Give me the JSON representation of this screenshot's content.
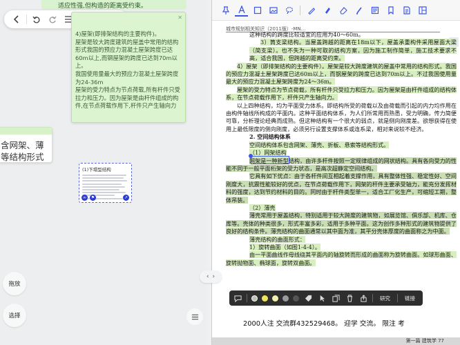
{
  "left_panel": {
    "top_note_text": "适应性强,但构造的距离受约束。",
    "toolbar": {
      "icons": [
        "chevron-left-icon",
        "undo-icon",
        "redo-icon",
        "list-icon",
        "edit-icon",
        "share-icon",
        "more-icon"
      ]
    },
    "note_main": {
      "lines": [
        "4)屋架(即排架结构的主要构件)。",
        "屋架是较大跨度建筑的屋盖中常用的结构形式我国的预应力混凝土屋架跨度已达60m以上,而钢屋架的跨度已达到70m以上。",
        "我国使用量最大的预应力混凝土屋架跨度为24-36m",
        "屋架的受力特点为节点荷载,所有杆件只受拉力和压力。因为屋架是由杆件组成的构件,在节点荷载作用下,杆件只产生轴向力"
      ]
    },
    "note_left": {
      "lines": [
        "含网架、薄",
        "等结构形式"
      ]
    },
    "thumbnail": {
      "title": "(1)下塌型结构"
    },
    "drag_label": "拖放",
    "select_label": "选择"
  },
  "split_control": {
    "left_glyph": "‹",
    "right_glyph": "›"
  },
  "pdf": {
    "header": "城市规划相关知识（2011版）-MN...",
    "page_badge": "1",
    "accent_color": "#3b55e6",
    "highlight_color": "#cae8aa",
    "paragraphs": [
      "这种结构的跨度比较适宜的应用为40～60m。",
      "3）筒支梁结构。当屋盖跨越的距离在18m以下，屋盖承重构件采用屋面大梁（简支梁）。也不失为一种可取的结构方案，因为施工制作简单，施工技术要求不高，适合我国，但跨越的距离受约束。",
      "4）屋架（即排架结构的主要构件）。屋架是较大跨度建筑的屋盖中常用的结构形式。我国的预应力混凝土屋架跨度已达60m以上，而钢屋架的跨度已达到70m以上。不过我国使用量最大的预应力混凝土屋架跨度为24～36m。",
      "屋架的受力特点为节点荷载，所有杆件只受拉力和压力。因为屋架是由杆件组成的结构体系，在节点荷载作用下，杆件只产生轴向力。",
      "以上四种结构，均为平面受力体系。即结构所受的荷载以及由荷载而引起的内力均作用在由构件轴线所构成的平面内。这种平面结构体系，为人们所常用而熟悉，受力明确，传力简便可靠，分析理论经典而成熟。但这种结构有一个很大的弱点，就是侧向刚度差。欲想获得在使用上最低限度的侧向刚度，必须另行设置支撑体系或连系梁，相对来说较不经济。",
      "2. 空间结构体系",
      "空间结构体系包含网架、薄壳、折板、悬索等结构形式。",
      "（1）网架结构",
      "网架是一种新型结构，由许多杆件按照一定规律组成的网状结构。具有各向受力的性能不同于一般平面桁架的受力状态，是高次超静定空间结构。",
      "它具有如下优点：由于各杆件间互相起着支撑作用，具有整体性强、稳定性好、空间刚度大，抗震性能较好的优点，在节点荷载作用下，网架的杆件主要承受轴力，能充分发挥材料的强度，达到节约材料的目的。同时由于杆件类型单一，适合工厂化生产，可缩短工期，整体吊装。",
      "（2）薄壳",
      "薄壳常用于屋盖结构，特别适用于较大跨度的建筑物，如展览馆、俱乐部、机库、仓库等。壳体的种类很多，形式丰富多彩，适用于多种平面。这为创作多种形式的建筑物提供了良好的结构条件。薄壳结构的曲面通常以其中面为准，其平分壳体厚度的曲面称之为中面。",
      "薄壳结构的曲面形式：",
      "1）旋转曲面（如图1-4-4）。",
      "由一平面曲线作母线绕其平面内的轴旋转而形成的曲面称为旋转曲面。如球形曲面、旋转抛物面、椭球面，旋转双曲面。"
    ],
    "context_menu": {
      "items": [
        "comment-icon",
        "color-gray",
        "color-yellow",
        "color-light-yellow",
        "color-dark-gray",
        "color-black",
        "tag-icon",
        "cursor-icon",
        "copy-icon",
        "delete-icon",
        "share-icon"
      ],
      "research_label": "研究",
      "link_label": "链接",
      "dot_colors": [
        "#b9c4ac",
        "#f0e45a",
        "#f3f0b0",
        "#9b9b9b",
        "#555555"
      ]
    },
    "footer_line": "2000人注 交流群432529468。 迎学 交流。 限注 考",
    "bottom_strip_text": "第一篇 建筑学 77"
  }
}
